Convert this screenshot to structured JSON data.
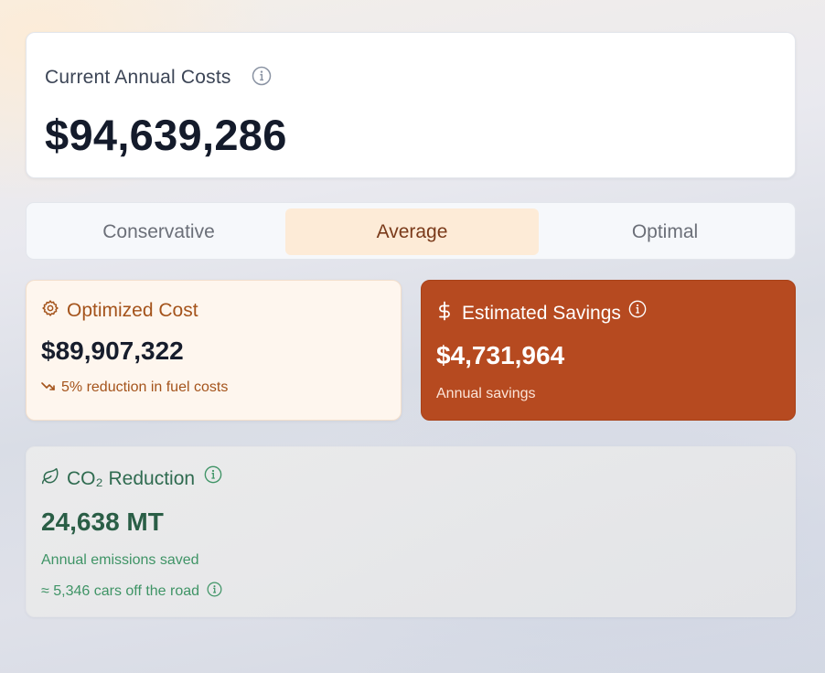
{
  "current": {
    "title": "Current Annual Costs",
    "amount": "$94,639,286"
  },
  "tabs": [
    {
      "label": "Conservative",
      "selected": false
    },
    {
      "label": "Average",
      "selected": true
    },
    {
      "label": "Optimal",
      "selected": false
    }
  ],
  "optimized": {
    "title": "Optimized Cost",
    "value": "$89,907,322",
    "note": "5% reduction in fuel costs",
    "icon": "gear-icon"
  },
  "savings": {
    "title": "Estimated Savings",
    "value": "$4,731,964",
    "note": "Annual savings",
    "icon": "dollar-icon"
  },
  "co2": {
    "title": "CO₂ Reduction",
    "value": "24,638 MT",
    "note": "Annual emissions saved",
    "equivalent": "≈ 5,346 cars off the road",
    "icon": "leaf-icon"
  },
  "colors": {
    "accent": "#b64a20",
    "accent_light": "#fdebd7",
    "green": "#2f6b50",
    "text_dark": "#141b2b"
  }
}
